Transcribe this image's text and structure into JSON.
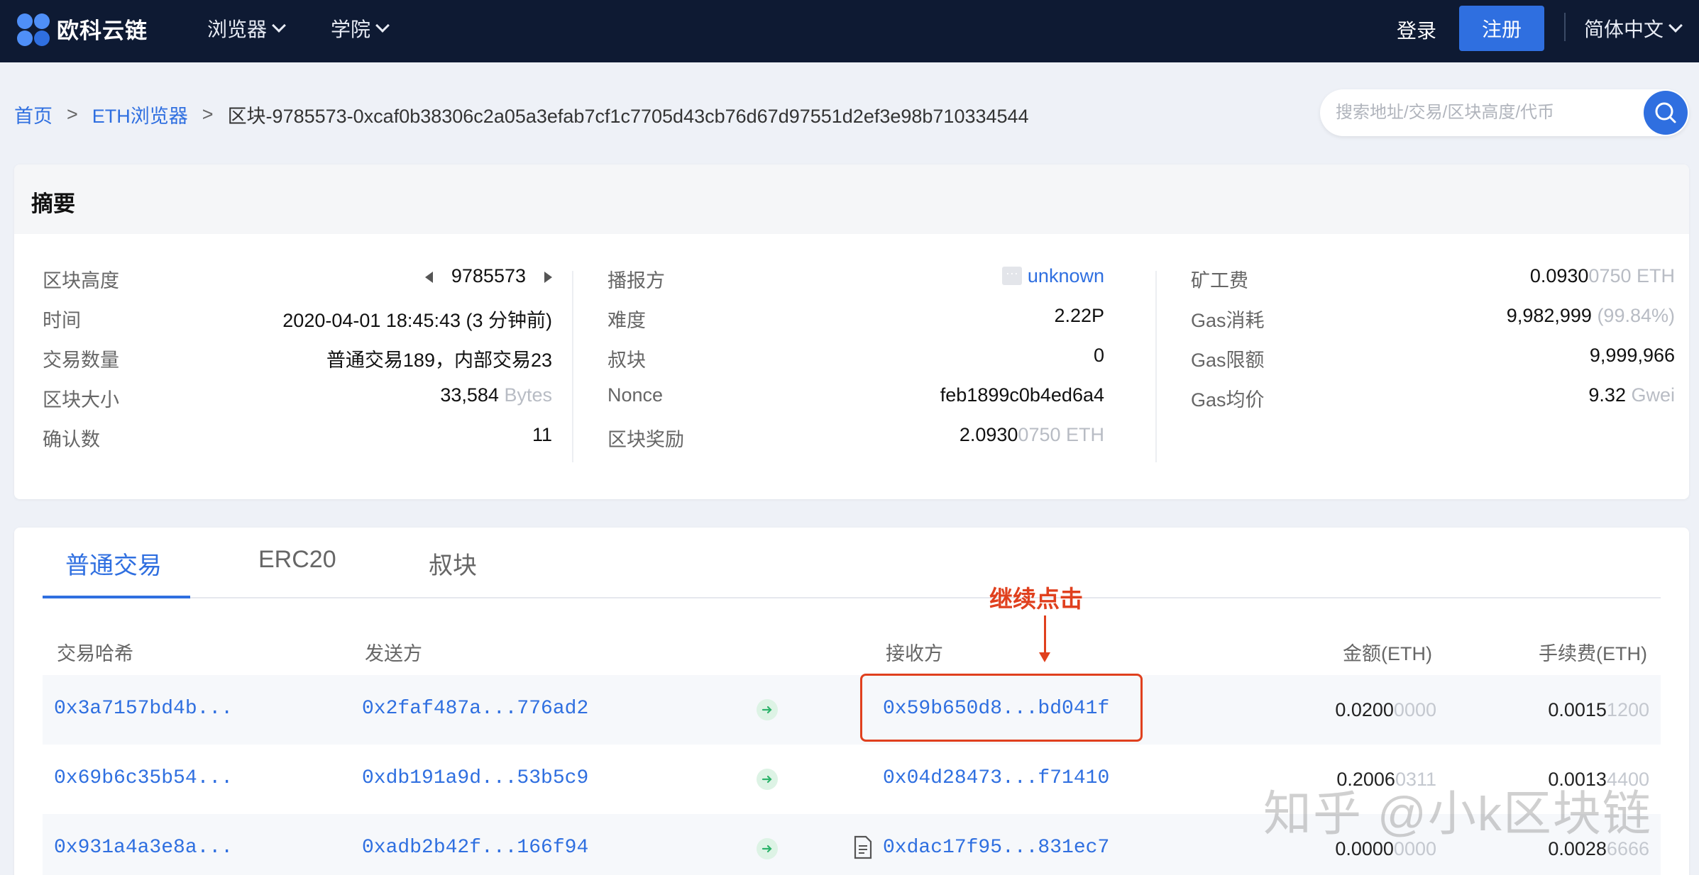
{
  "nav": {
    "logo_text": "欧科云链",
    "menu": [
      {
        "label": "浏览器"
      },
      {
        "label": "学院"
      }
    ],
    "login": "登录",
    "register": "注册",
    "language": "简体中文"
  },
  "breadcrumb": {
    "home": "首页",
    "sep1": ">",
    "eth": "ETH浏览器",
    "sep2": ">",
    "current": "区块-9785573-0xcaf0b38306c2a05a3efab7cf1c7705d43cb76d67d97551d2ef3e98b710334544"
  },
  "search": {
    "placeholder": "搜索地址/交易/区块高度/代币"
  },
  "summary": {
    "title": "摘要",
    "col1": [
      {
        "key": "区块高度",
        "value": "9785573"
      },
      {
        "key": "时间",
        "value": "2020-04-01 18:45:43 (3 分钟前)"
      },
      {
        "key": "交易数量",
        "value": "普通交易189，内部交易23"
      },
      {
        "key": "区块大小",
        "value": "33,584",
        "unit": "Bytes"
      },
      {
        "key": "确认数",
        "value": "11"
      }
    ],
    "col2": [
      {
        "key": "播报方",
        "value": "unknown",
        "icon": "···"
      },
      {
        "key": "难度",
        "value": "2.22P"
      },
      {
        "key": "叔块",
        "value": "0"
      },
      {
        "key": "Nonce",
        "value": "feb1899c0b4ed6a4"
      },
      {
        "key": "区块奖励",
        "value": "2.0930",
        "dim": "0750 ETH"
      }
    ],
    "col3": [
      {
        "key": "矿工费",
        "value": "0.0930",
        "dim": "0750 ETH"
      },
      {
        "key": "Gas消耗",
        "value": "9,982,999",
        "dim": "(99.84%)"
      },
      {
        "key": "Gas限额",
        "value": "9,999,966"
      },
      {
        "key": "Gas均价",
        "value": "9.32",
        "dim": "Gwei"
      }
    ]
  },
  "tabs": [
    {
      "label": "普通交易",
      "active": true
    },
    {
      "label": "ERC20",
      "active": false
    },
    {
      "label": "叔块",
      "active": false
    }
  ],
  "table": {
    "headers": {
      "hash": "交易哈希",
      "from": "发送方",
      "to": "接收方",
      "amount": "金额(ETH)",
      "fee": "手续费(ETH)"
    },
    "rows": [
      {
        "hash": "0x3a7157bd4b...",
        "from": "0x2faf487a...776ad2",
        "to": "0x59b650d8...bd041f",
        "amount": "0.0200",
        "amount_dim": "0000",
        "fee": "0.0015",
        "fee_dim": "1200",
        "contract": false
      },
      {
        "hash": "0x69b6c35b54...",
        "from": "0xdb191a9d...53b5c9",
        "to": "0x04d28473...f71410",
        "amount": "0.2006",
        "amount_dim": "0311",
        "fee": "0.0013",
        "fee_dim": "4400",
        "contract": false
      },
      {
        "hash": "0x931a4a3e8a...",
        "from": "0xadb2b42f...166f94",
        "to": "0xdac17f95...831ec7",
        "amount": "0.0000",
        "amount_dim": "0000",
        "fee": "0.0028",
        "fee_dim": "6666",
        "contract": true
      }
    ]
  },
  "annotation": {
    "text": "继续点击",
    "color": "#e0401e"
  },
  "watermark": "知乎 @小k区块链",
  "colors": {
    "nav_bg": "#0e1a33",
    "accent": "#2f6fe0",
    "page_bg": "#eef1f7"
  }
}
